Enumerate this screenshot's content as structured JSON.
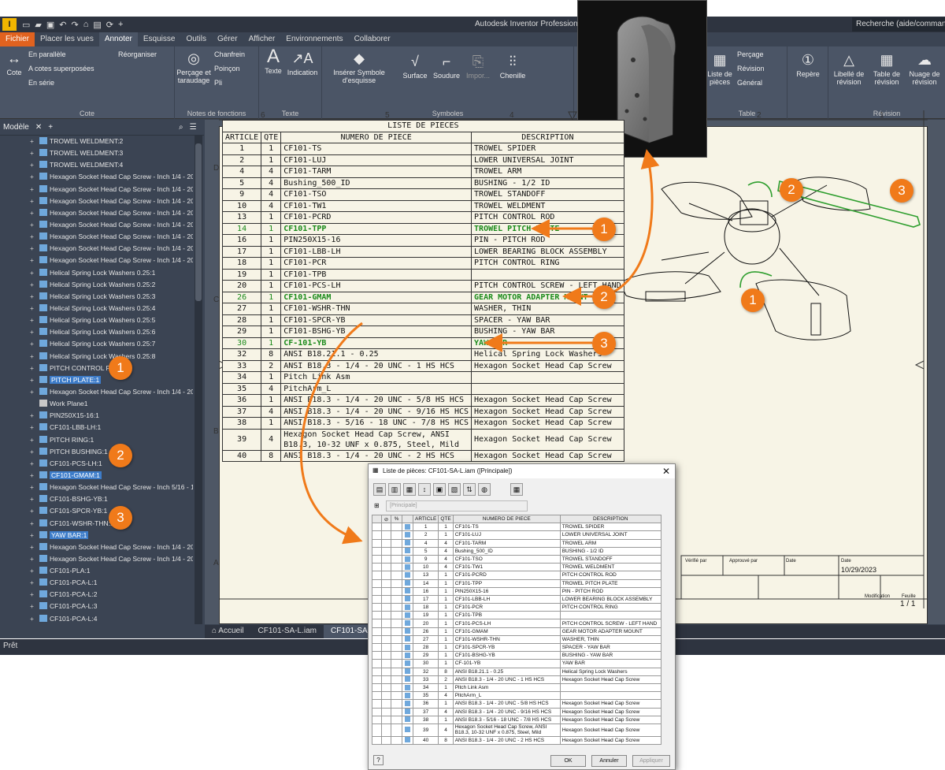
{
  "app": {
    "title": "Autodesk Inventor Professional 20",
    "search_placeholder": "Recherche (aide/commande",
    "status": "Prêt"
  },
  "ribbon_tabs": [
    "Fichier",
    "Placer les vues",
    "Annoter",
    "Esquisse",
    "Outils",
    "Gérer",
    "Afficher",
    "Environnements",
    "Collaborer"
  ],
  "ribbon": {
    "cote": {
      "title": "Cote",
      "main": "Cote",
      "items": [
        "En parallèle",
        "A cotes superposées",
        "En série",
        "Réorganiser"
      ]
    },
    "fonctions": {
      "title": "Notes de fonctions",
      "main": "Perçage et taraudage",
      "items": [
        "Chanfrein",
        "Poinçon",
        "Pli"
      ]
    },
    "texte": {
      "title": "Texte",
      "items": [
        "Texte",
        "Indication"
      ]
    },
    "symboles": {
      "title": "Symboles",
      "main": "Insérer Symbole d'esquisse",
      "items": [
        "Surface",
        "Soudure",
        "Impor...",
        "Chenille"
      ]
    },
    "table": {
      "title": "Table",
      "items": [
        "Liste de pièces",
        "Perçage",
        "Révision",
        "Général"
      ]
    },
    "repere": {
      "label": "Repère"
    },
    "revision": {
      "title": "Révision",
      "items": [
        "Libellé de révision",
        "Table de révision",
        "Nuage de révision"
      ]
    }
  },
  "browser": {
    "tab": "Modèle",
    "items": [
      {
        "label": "TROWEL WELDMENT:2",
        "icon": "weld"
      },
      {
        "label": "TROWEL WELDMENT:3",
        "icon": "weld"
      },
      {
        "label": "TROWEL WELDMENT:4",
        "icon": "weld"
      },
      {
        "label": "Hexagon Socket Head Cap Screw - Inch 1/4 - 20 U",
        "icon": "screw"
      },
      {
        "label": "Hexagon Socket Head Cap Screw - Inch 1/4 - 20 U",
        "icon": "screw"
      },
      {
        "label": "Hexagon Socket Head Cap Screw - Inch 1/4 - 20 U",
        "icon": "screw"
      },
      {
        "label": "Hexagon Socket Head Cap Screw - Inch 1/4 - 20 U",
        "icon": "screw"
      },
      {
        "label": "Hexagon Socket Head Cap Screw - Inch 1/4 - 20 U",
        "icon": "screw"
      },
      {
        "label": "Hexagon Socket Head Cap Screw - Inch 1/4 - 20 U",
        "icon": "screw"
      },
      {
        "label": "Hexagon Socket Head Cap Screw - Inch 1/4 - 20 U",
        "icon": "screw"
      },
      {
        "label": "Hexagon Socket Head Cap Screw - Inch 1/4 - 20 U",
        "icon": "screw"
      },
      {
        "label": "Helical Spring Lock Washers 0.25:1",
        "icon": "screw"
      },
      {
        "label": "Helical Spring Lock Washers 0.25:2",
        "icon": "screw"
      },
      {
        "label": "Helical Spring Lock Washers 0.25:3",
        "icon": "screw"
      },
      {
        "label": "Helical Spring Lock Washers 0.25:4",
        "icon": "screw"
      },
      {
        "label": "Helical Spring Lock Washers 0.25:5",
        "icon": "screw"
      },
      {
        "label": "Helical Spring Lock Washers 0.25:6",
        "icon": "screw"
      },
      {
        "label": "Helical Spring Lock Washers 0.25:7",
        "icon": "screw"
      },
      {
        "label": "Helical Spring Lock Washers 0.25:8",
        "icon": "screw"
      },
      {
        "label": "PITCH CONTROL ROD:1",
        "icon": "part"
      },
      {
        "label": "PITCH PLATE:1",
        "icon": "part",
        "selected": true
      },
      {
        "label": "Hexagon Socket Head Cap Screw - Inch 1/4 - 20 U",
        "icon": "screw"
      },
      {
        "label": "Work Plane1",
        "icon": "plane"
      },
      {
        "label": "PIN250X15-16:1",
        "icon": "part"
      },
      {
        "label": "CF101-LBB-LH:1",
        "icon": "asm"
      },
      {
        "label": "PITCH RING:1",
        "icon": "part"
      },
      {
        "label": "PITCH BUSHING:1",
        "icon": "part"
      },
      {
        "label": "CF101-PCS-LH:1",
        "icon": "part"
      },
      {
        "label": "CF101-GMAM:1",
        "icon": "part",
        "selected": true
      },
      {
        "label": "Hexagon Socket Head Cap Screw - Inch 5/16 - 18",
        "icon": "screw"
      },
      {
        "label": "CF101-BSHG-YB:1",
        "icon": "part"
      },
      {
        "label": "CF101-SPCR-YB:1",
        "icon": "part"
      },
      {
        "label": "CF101-WSHR-THN:1",
        "icon": "part"
      },
      {
        "label": "YAW BAR:1",
        "icon": "part",
        "selected": true
      },
      {
        "label": "Hexagon Socket Head Cap Screw - Inch 1/4 - 20 U",
        "icon": "screw"
      },
      {
        "label": "Hexagon Socket Head Cap Screw - Inch 1/4 - 20 U",
        "icon": "screw"
      },
      {
        "label": "CF101-PLA:1",
        "icon": "asm"
      },
      {
        "label": "CF101-PCA-L:1",
        "icon": "asm"
      },
      {
        "label": "CF101-PCA-L:2",
        "icon": "asm"
      },
      {
        "label": "CF101-PCA-L:3",
        "icon": "asm"
      },
      {
        "label": "CF101-PCA-L:4",
        "icon": "asm"
      }
    ]
  },
  "doc_tabs": [
    "Accueil",
    "CF101-SA-L.iam",
    "CF101-SA-L"
  ],
  "drawing": {
    "col_labels": [
      "6",
      "5",
      "4",
      "2",
      "1"
    ],
    "row_labels": [
      "D",
      "C",
      "B",
      "A"
    ],
    "title_block": {
      "verifie": "Vérifié par",
      "approuve": "Approuvé par",
      "date_label": "Date",
      "date_label2": "Date",
      "date": "10/29/2023",
      "modif": "Modification",
      "feuille": "Feuille",
      "feuille_val": "1 / 1"
    }
  },
  "bom": {
    "title": "LISTE DE PIECES",
    "headers": [
      "ARTICLE",
      "QTE",
      "NUMERO DE PIECE",
      "DESCRIPTION"
    ],
    "rows": [
      {
        "a": "1",
        "q": "1",
        "p": "CF101-TS",
        "d": "TROWEL SPIDER"
      },
      {
        "a": "2",
        "q": "1",
        "p": "CF101-LUJ",
        "d": "LOWER UNIVERSAL JOINT"
      },
      {
        "a": "4",
        "q": "4",
        "p": "CF101-TARM",
        "d": "TROWEL ARM"
      },
      {
        "a": "5",
        "q": "4",
        "p": "Bushing_500_ID",
        "d": "BUSHING - 1/2 ID"
      },
      {
        "a": "9",
        "q": "4",
        "p": "CF101-TSO",
        "d": "TROWEL STANDOFF"
      },
      {
        "a": "10",
        "q": "4",
        "p": "CF101-TW1",
        "d": "TROWEL WELDMENT"
      },
      {
        "a": "13",
        "q": "1",
        "p": "CF101-PCRD",
        "d": "PITCH CONTROL ROD"
      },
      {
        "a": "14",
        "q": "1",
        "p": "CF101-TPP",
        "d": "TROWEL PITCH PLATE",
        "hl": true
      },
      {
        "a": "16",
        "q": "1",
        "p": "PIN250X15-16",
        "d": "PIN - PITCH ROD"
      },
      {
        "a": "17",
        "q": "1",
        "p": "CF101-LBB-LH",
        "d": "LOWER BEARING BLOCK ASSEMBLY"
      },
      {
        "a": "18",
        "q": "1",
        "p": "CF101-PCR",
        "d": "PITCH CONTROL RING"
      },
      {
        "a": "19",
        "q": "1",
        "p": "CF101-TPB",
        "d": ""
      },
      {
        "a": "20",
        "q": "1",
        "p": "CF101-PCS-LH",
        "d": "PITCH CONTROL SCREW - LEFT HAND"
      },
      {
        "a": "26",
        "q": "1",
        "p": "CF101-GMAM",
        "d": "GEAR MOTOR ADAPTER MOUNT",
        "hl": true
      },
      {
        "a": "27",
        "q": "1",
        "p": "CF101-WSHR-THN",
        "d": "WASHER, THIN"
      },
      {
        "a": "28",
        "q": "1",
        "p": "CF101-SPCR-YB",
        "d": "SPACER - YAW BAR"
      },
      {
        "a": "29",
        "q": "1",
        "p": "CF101-BSHG-YB",
        "d": "BUSHING - YAW BAR"
      },
      {
        "a": "30",
        "q": "1",
        "p": "CF-101-YB",
        "d": "YAW BAR",
        "hl": true
      },
      {
        "a": "32",
        "q": "8",
        "p": "ANSI B18.21.1 - 0.25",
        "d": "Helical Spring Lock Washers"
      },
      {
        "a": "33",
        "q": "2",
        "p": "ANSI B18.3 - 1/4 - 20 UNC - 1 HS HCS",
        "d": "Hexagon Socket Head Cap Screw"
      },
      {
        "a": "34",
        "q": "1",
        "p": "Pitch Link Asm",
        "d": ""
      },
      {
        "a": "35",
        "q": "4",
        "p": "PitchArm_L",
        "d": ""
      },
      {
        "a": "36",
        "q": "1",
        "p": "ANSI B18.3 - 1/4 - 20 UNC - 5/8 HS HCS",
        "d": "Hexagon Socket Head Cap Screw"
      },
      {
        "a": "37",
        "q": "4",
        "p": "ANSI B18.3 - 1/4 - 20 UNC - 9/16 HS HCS",
        "d": "Hexagon Socket Head Cap Screw"
      },
      {
        "a": "38",
        "q": "1",
        "p": "ANSI B18.3 - 5/16 - 18 UNC - 7/8 HS HCS",
        "d": "Hexagon Socket Head Cap Screw"
      },
      {
        "a": "39",
        "q": "4",
        "p": "Hexagon Socket Head Cap Screw, ANSI B18.3, 10-32 UNF x 0.875, Steel, Mild",
        "d": "Hexagon Socket Head Cap Screw",
        "wrap": true
      },
      {
        "a": "40",
        "q": "8",
        "p": "ANSI B18.3 - 1/4 - 20 UNC - 2 HS HCS",
        "d": "Hexagon Socket Head Cap Screw"
      }
    ]
  },
  "badges": [
    "1",
    "2",
    "3"
  ],
  "dialog": {
    "title": "Liste de pièces: CF101-SA-L.iam ([Principale])",
    "view": "[Principale]",
    "ok": "OK",
    "cancel": "Annuler",
    "apply": "Appliquer"
  }
}
